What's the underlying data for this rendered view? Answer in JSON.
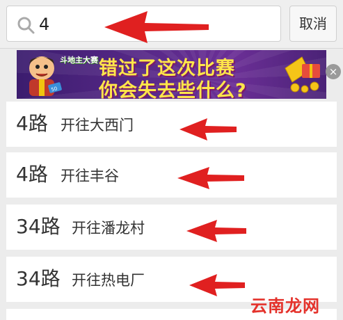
{
  "search": {
    "value": "4",
    "cancel_label": "取消"
  },
  "ad": {
    "logo_text": "斗地主大赛",
    "line1": "错过了这次比赛",
    "line2": "你会失去些什么?",
    "close_symbol": "×",
    "badge": "50"
  },
  "results": [
    {
      "route": "4路",
      "destination": "开往大西门"
    },
    {
      "route": "4路",
      "destination": "开往丰谷"
    },
    {
      "route": "34路",
      "destination": "开往潘龙村"
    },
    {
      "route": "34路",
      "destination": "开往热电厂"
    }
  ],
  "annotations": {
    "arrow_color": "#e02020"
  },
  "watermark": "云南龙网"
}
